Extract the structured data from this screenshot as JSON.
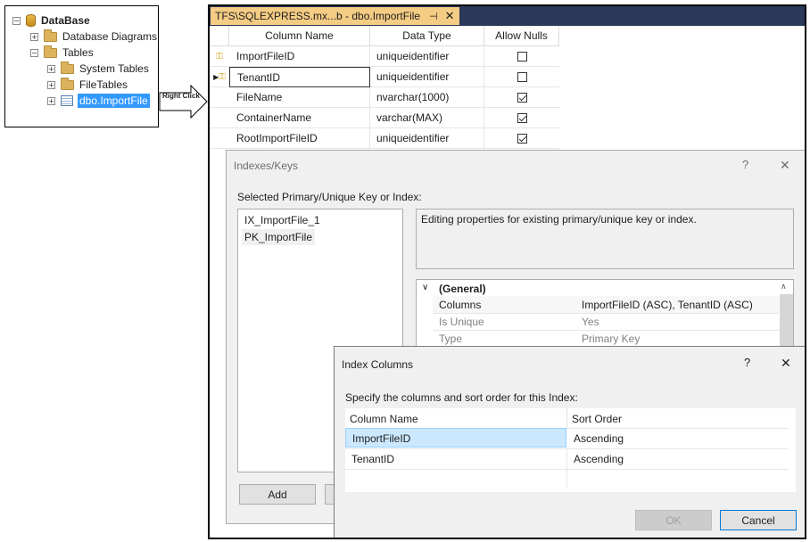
{
  "tree": {
    "root": "DataBase",
    "items": [
      {
        "label": "Database Diagrams"
      },
      {
        "label": "Tables"
      },
      {
        "label": "System Tables"
      },
      {
        "label": "FileTables"
      },
      {
        "label": "dbo.ImportFile"
      }
    ]
  },
  "annotation": {
    "right_click": "Right Click"
  },
  "tab": {
    "title": "TFS\\SQLEXPRESS.mx...b - dbo.ImportFile",
    "pin_glyph": "⊣",
    "close_glyph": "✕"
  },
  "grid": {
    "headers": [
      "Column Name",
      "Data Type",
      "Allow Nulls"
    ],
    "rows": [
      {
        "name": "ImportFileID",
        "type": "uniqueidentifier",
        "nulls": false,
        "key": true
      },
      {
        "name": "TenantID",
        "type": "uniqueidentifier",
        "nulls": false,
        "key": true
      },
      {
        "name": "FileName",
        "type": "nvarchar(1000)",
        "nulls": true,
        "key": false
      },
      {
        "name": "ContainerName",
        "type": "varchar(MAX)",
        "nulls": true,
        "key": false
      },
      {
        "name": "RootImportFileID",
        "type": "uniqueidentifier",
        "nulls": true,
        "key": false
      }
    ]
  },
  "indexes_dialog": {
    "title": "Indexes/Keys",
    "help": "?",
    "close": "✕",
    "list_label": "Selected Primary/Unique Key or Index:",
    "list": [
      "IX_ImportFile_1",
      "PK_ImportFile"
    ],
    "description": "Editing properties for existing primary/unique key or index.",
    "section": "(General)",
    "props": [
      {
        "name": "Columns",
        "value": "ImportFileID (ASC), TenantID (ASC)"
      },
      {
        "name": "Is Unique",
        "value": "Yes"
      },
      {
        "name": "Type",
        "value": "Primary Key"
      }
    ],
    "add_label": "Add"
  },
  "columns_dialog": {
    "title": "Index Columns",
    "help": "?",
    "close": "✕",
    "instruction": "Specify the columns and sort order for this Index:",
    "headers": [
      "Column Name",
      "Sort Order"
    ],
    "rows": [
      {
        "column": "ImportFileID",
        "order": "Ascending"
      },
      {
        "column": "TenantID",
        "order": "Ascending"
      }
    ],
    "ok_label": "OK",
    "cancel_label": "Cancel"
  }
}
